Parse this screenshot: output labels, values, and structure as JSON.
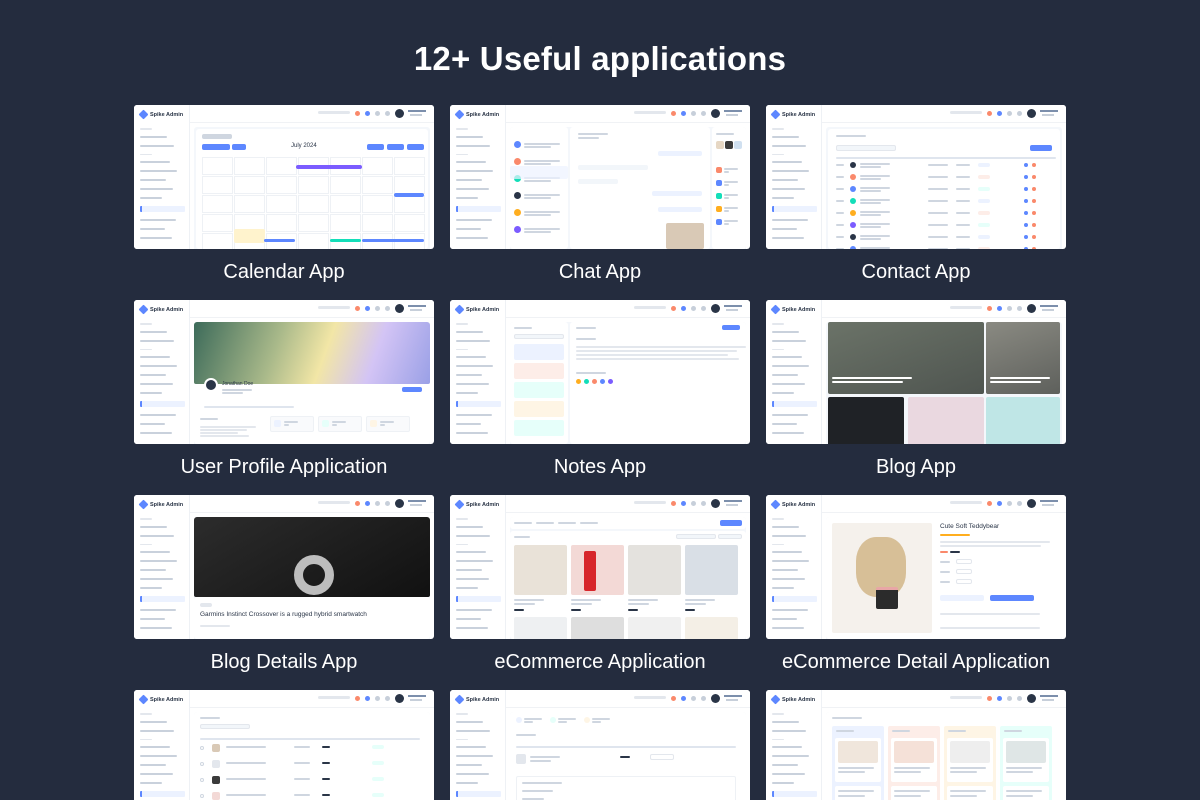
{
  "headline": "12+ Useful applications",
  "brand": "Spike Admin",
  "apps": [
    {
      "name": "Calendar App",
      "screen": "calendar",
      "month": "July 2024"
    },
    {
      "name": "Chat App",
      "screen": "chat"
    },
    {
      "name": "Contact App",
      "screen": "contact"
    },
    {
      "name": "User Profile Application",
      "screen": "profile",
      "user_name": "Jonathan Doe"
    },
    {
      "name": "Notes App",
      "screen": "notes"
    },
    {
      "name": "Blog App",
      "screen": "blog"
    },
    {
      "name": "Blog Details App",
      "screen": "blog-details",
      "post_title": "Garmins Instinct Crossover is a rugged hybrid smartwatch"
    },
    {
      "name": "eCommerce Application",
      "screen": "ecommerce"
    },
    {
      "name": "eCommerce Detail Application",
      "screen": "ecommerce-detail",
      "product_title": "Cute Soft Teddybear"
    },
    {
      "name": "",
      "screen": "product-list"
    },
    {
      "name": "",
      "screen": "cart"
    },
    {
      "name": "",
      "screen": "kanban"
    }
  ],
  "colors": {
    "background": "#242c3e",
    "primary": "#5d87ff",
    "card": "#ffffff",
    "accent_purple": "#7b5cff",
    "accent_green": "#13deb9",
    "accent_orange": "#ffae1f"
  }
}
